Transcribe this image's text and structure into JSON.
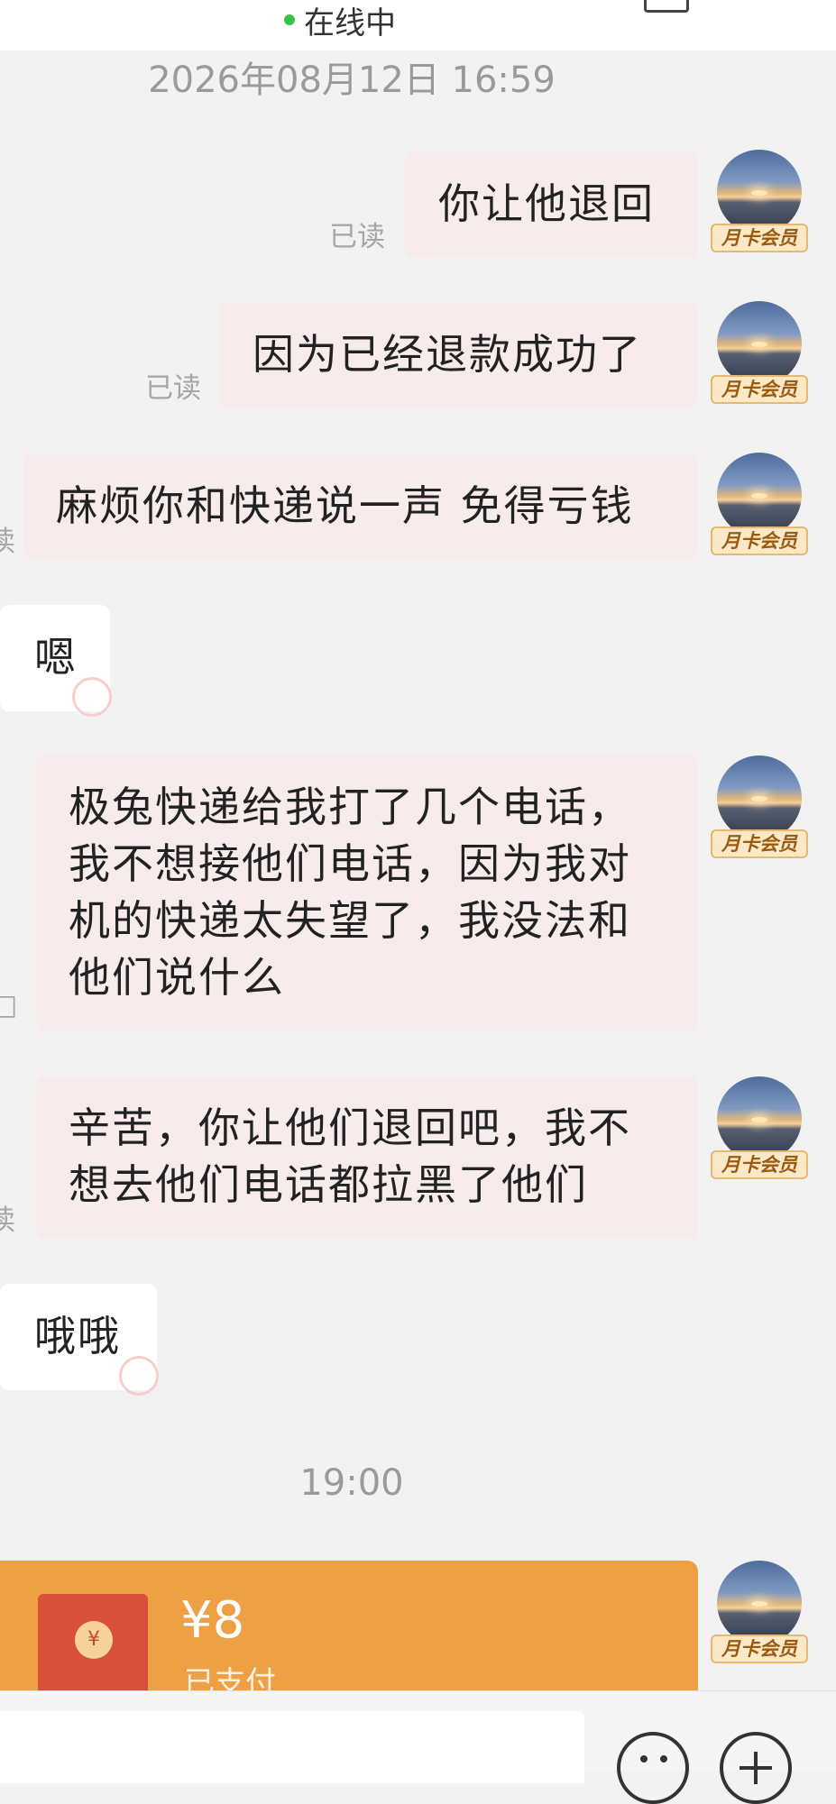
{
  "header": {
    "status_text": "在线中"
  },
  "timestamps": [
    "2026年08月12日 16:59",
    "19:00"
  ],
  "read_label": "已读",
  "vip_label": "月卡会员",
  "messages": [
    {
      "sender": "me",
      "text": "你让他退回",
      "read": "已读"
    },
    {
      "sender": "me",
      "text": "因为已经退款成功了",
      "read": "已读"
    },
    {
      "sender": "me",
      "text": "麻烦你和快递说一声 免得亏钱",
      "read": "读"
    },
    {
      "sender": "them",
      "text": "嗯"
    },
    {
      "sender": "me",
      "lines": [
        "极兔快递给我打了几个电话，",
        "我不想接他们电话，因为我对",
        "机的快递太失望了，我没法和",
        "他们说什么"
      ],
      "read": "□"
    },
    {
      "sender": "me",
      "lines": [
        "辛苦，你让他们退回吧，我不",
        "想去他们电话都拉黑了他们"
      ],
      "read": "读"
    },
    {
      "sender": "them",
      "text": "哦哦"
    }
  ],
  "red_packet": {
    "amount": "¥8",
    "status": "已支付",
    "coin_symbol": "¥"
  },
  "colors": {
    "self_bubble": "#f7eceb",
    "other_bubble": "#ffffff",
    "red_packet": "#eda044",
    "online_dot": "#3cbf4a"
  },
  "icons": [
    "emoji-icon",
    "plus-icon",
    "avatar-image"
  ]
}
